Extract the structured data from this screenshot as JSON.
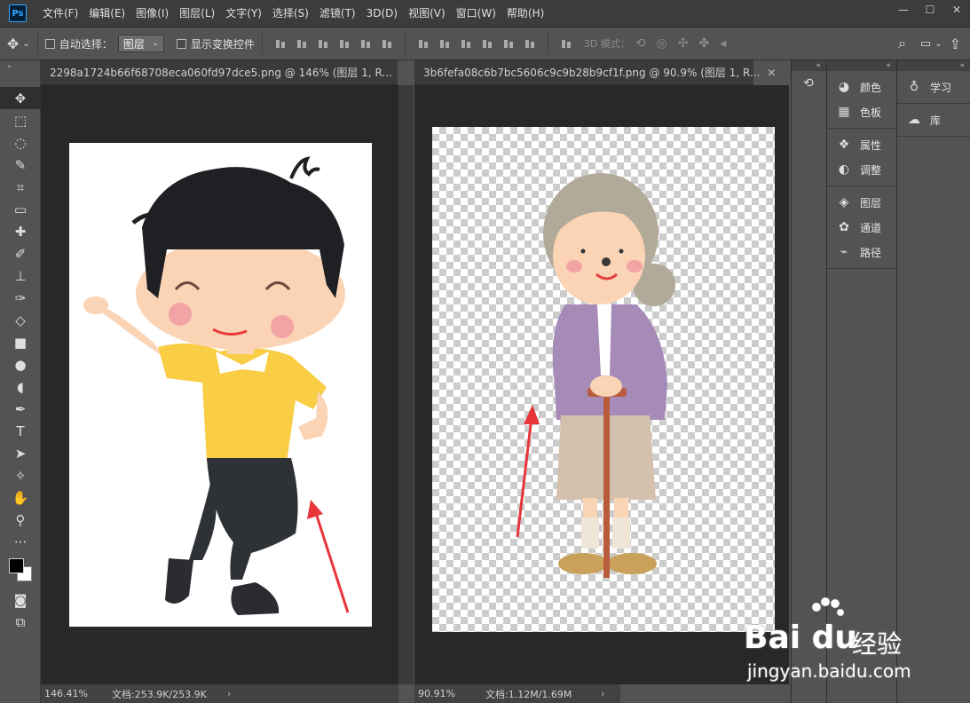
{
  "app": {
    "logo": "Ps"
  },
  "menu": [
    "文件(F)",
    "编辑(E)",
    "图像(I)",
    "图层(L)",
    "文字(Y)",
    "选择(S)",
    "滤镜(T)",
    "3D(D)",
    "视图(V)",
    "窗口(W)",
    "帮助(H)"
  ],
  "window_controls": {
    "minimize": "—",
    "maximize": "☐",
    "close": "✕"
  },
  "options": {
    "auto_select_label": "自动选择：",
    "auto_select_target": "图层",
    "show_transform_label": "显示变换控件",
    "mode_3d_label": "3D 模式："
  },
  "toolbar": {
    "tools": [
      "move-tool",
      "marquee-tool",
      "lasso-tool",
      "quick-select-tool",
      "crop-tool",
      "ruler-tool",
      "healing-brush-tool",
      "brush-tool",
      "clone-stamp-tool",
      "history-brush-tool",
      "eraser-tool",
      "gradient-tool",
      "blur-tool",
      "dodge-tool",
      "pen-tool",
      "type-tool",
      "path-select-tool",
      "custom-shape-tool",
      "hand-tool",
      "zoom-tool",
      "more-tools"
    ],
    "foreground_color": "#000000",
    "background_color": "#ffffff"
  },
  "documents": [
    {
      "tab": "2298a1724b66f68708eca060fd97dce5.png @ 146% (图层 1, R...",
      "zoom": "146.41%",
      "doc_info": "文档:253.9K/253.9K"
    },
    {
      "tab": "3b6fefa08c6b7bc5606c9c9b28b9cf1f.png @ 90.9% (图层 1, R...",
      "zoom": "90.91%",
      "doc_info": "文档:1.12M/1.69M"
    }
  ],
  "panels": {
    "group1": [
      {
        "icon": "palette-icon",
        "label": "颜色"
      },
      {
        "icon": "swatches-icon",
        "label": "色板"
      }
    ],
    "group2": [
      {
        "icon": "properties-icon",
        "label": "属性"
      },
      {
        "icon": "adjustments-icon",
        "label": "调整"
      }
    ],
    "group3": [
      {
        "icon": "layers-icon",
        "label": "图层"
      },
      {
        "icon": "channels-icon",
        "label": "通道"
      },
      {
        "icon": "paths-icon",
        "label": "路径"
      }
    ],
    "right": [
      {
        "icon": "lightbulb-icon",
        "label": "学习"
      },
      {
        "icon": "library-icon",
        "label": "库"
      }
    ]
  },
  "watermark": {
    "brand": "Bai du",
    "cn": "经验",
    "url": "jingyan.baidu.com"
  },
  "colors": {
    "accent": "#31a8ff",
    "arrow": "#e8353a",
    "shirt_yellow": "#f9cd44",
    "cardigan": "#a68bb8"
  }
}
